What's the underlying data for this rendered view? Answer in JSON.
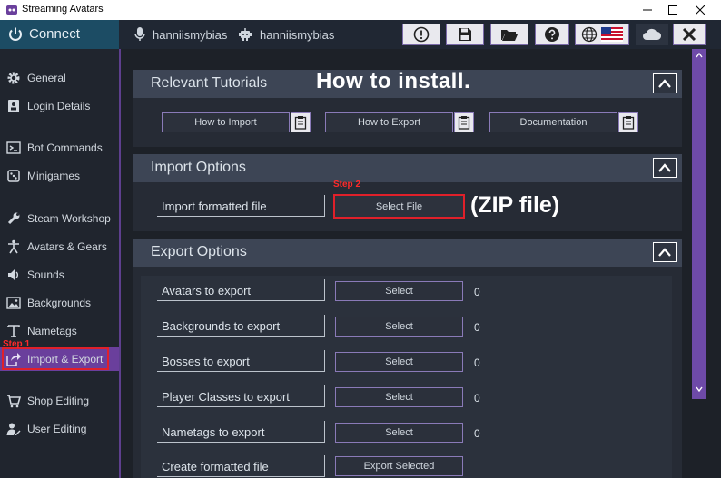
{
  "window": {
    "title": "Streaming Avatars"
  },
  "topbar": {
    "connect_label": "Connect",
    "user_mic_name": "hanniismybias",
    "user_bot_name": "hanniismybias",
    "toolbar_icons": [
      "alert-icon",
      "save-icon",
      "folder-icon",
      "help-icon",
      "globe-icon",
      "us-flag-icon",
      "cloud-icon",
      "close-icon"
    ]
  },
  "sidebar": {
    "items": [
      {
        "label": "General",
        "icon": "gear-icon"
      },
      {
        "label": "Login Details",
        "icon": "id-card-icon"
      },
      {
        "label": "Bot Commands",
        "icon": "terminal-icon"
      },
      {
        "label": "Minigames",
        "icon": "dice-icon"
      },
      {
        "label": "Steam Workshop",
        "icon": "wrench-icon"
      },
      {
        "label": "Avatars & Gears",
        "icon": "person-icon"
      },
      {
        "label": "Sounds",
        "icon": "speaker-icon"
      },
      {
        "label": "Backgrounds",
        "icon": "image-icon"
      },
      {
        "label": "Nametags",
        "icon": "text-icon"
      },
      {
        "label": "Import & Export",
        "icon": "export-icon",
        "active": true
      },
      {
        "label": "Shop Editing",
        "icon": "cart-icon"
      },
      {
        "label": "User Editing",
        "icon": "user-edit-icon"
      }
    ]
  },
  "annotations": {
    "step1": "Step 1",
    "step2": "Step 2",
    "how_to_install": "How to install.",
    "zip_file": "(ZIP file)"
  },
  "tutorials": {
    "title": "Relevant Tutorials",
    "buttons": [
      "How to Import",
      "How to Export",
      "Documentation"
    ]
  },
  "import": {
    "title": "Import Options",
    "row_label": "Import formatted file",
    "button": "Select File"
  },
  "export": {
    "title": "Export Options",
    "rows": [
      {
        "label": "Avatars to export",
        "button": "Select",
        "count": "0"
      },
      {
        "label": "Backgrounds to export",
        "button": "Select",
        "count": "0"
      },
      {
        "label": "Bosses to export",
        "button": "Select",
        "count": "0"
      },
      {
        "label": "Player Classes to export",
        "button": "Select",
        "count": "0"
      },
      {
        "label": "Nametags to export",
        "button": "Select",
        "count": "0"
      }
    ],
    "create_label": "Create formatted file",
    "create_button": "Export Selected"
  },
  "colors": {
    "accent_purple": "#6a3f9c",
    "connect_bg": "#1c4c64",
    "annotation_red": "#e0202a"
  }
}
